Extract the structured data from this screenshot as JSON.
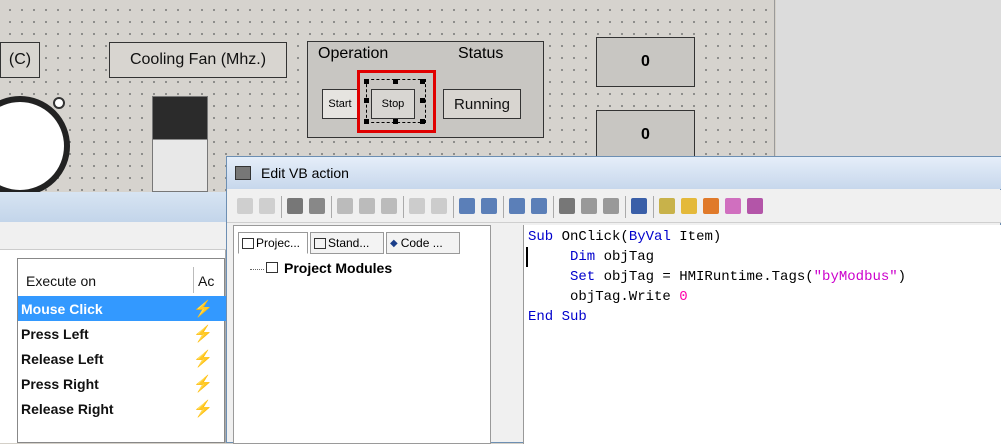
{
  "canvas": {
    "labels": {
      "temp_partial": "(C)",
      "cooling_fan": "Cooling Fan (Mhz.)"
    },
    "operation_group": {
      "operation_label": "Operation",
      "status_label": "Status",
      "start_button": "Start",
      "stop_button": "Stop",
      "running_label": "Running"
    },
    "displays": {
      "top_value": "0",
      "bottom_value": "0"
    },
    "selection_color": "#e00000"
  },
  "events_panel": {
    "header_execute": "Execute on",
    "header_action_partial": "Ac",
    "rows": [
      {
        "label": "Mouse Click",
        "selected": true
      },
      {
        "label": "Press Left",
        "selected": false
      },
      {
        "label": "Release Left",
        "selected": false
      },
      {
        "label": "Press Right",
        "selected": false
      },
      {
        "label": "Release Right",
        "selected": false
      }
    ]
  },
  "dialog": {
    "title": "Edit VB action",
    "tabs": [
      "Projec...",
      "Stand...",
      "Code ..."
    ],
    "tree_root": "Project Modules",
    "code": {
      "line1_kw": "Sub",
      "line1_rest": " OnClick(",
      "line1_kw2": "ByVal",
      "line1_end": " Item)",
      "line2_kw": "Dim",
      "line2_rest": " objTag",
      "line3_kw": "Set",
      "line3_rest": " objTag = HMIRuntime.Tags(",
      "line3_str": "\"byModbus\"",
      "line3_end": ")",
      "line4_rest": "objTag.Write ",
      "line4_num": "0",
      "line5_kw": "End Sub"
    }
  }
}
